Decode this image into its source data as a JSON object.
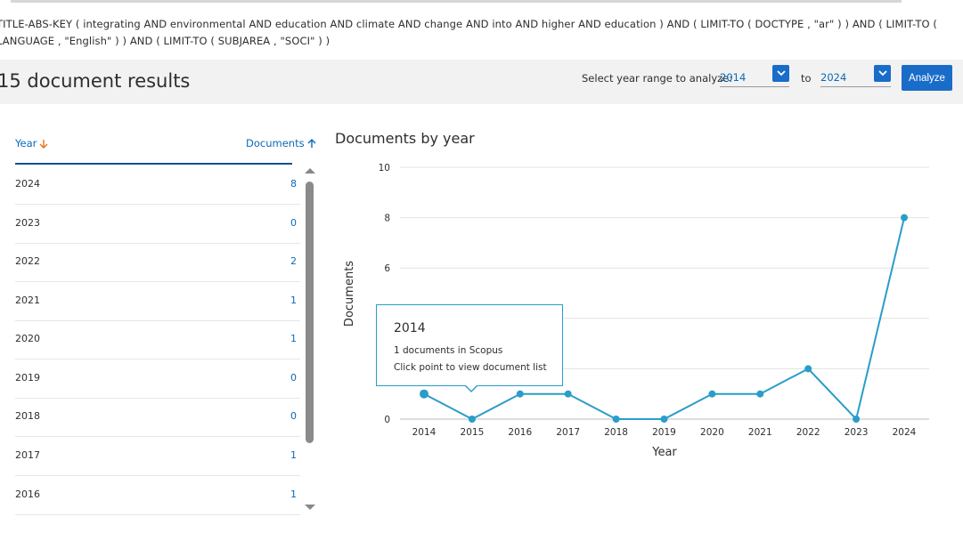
{
  "query": {
    "text": "TITLE-ABS-KEY ( integrating AND environmental AND education AND climate AND change AND into AND higher AND education ) AND ( LIMIT-TO ( DOCTYPE , \"ar\" ) ) AND ( LIMIT-TO ( LANGUAGE , \"English\" ) ) AND ( LIMIT-TO ( SUBJAREA , \"SOCI\" ) )"
  },
  "results": {
    "title": "15 document results"
  },
  "year_range": {
    "label": "Select year range to analyze:",
    "from": "2014",
    "to_label": "to",
    "to": "2024",
    "analyze_label": "Analyze"
  },
  "table": {
    "headers": {
      "year": "Year",
      "documents": "Documents"
    },
    "rows": [
      {
        "year": "2024",
        "count": "8"
      },
      {
        "year": "2023",
        "count": "0"
      },
      {
        "year": "2022",
        "count": "2"
      },
      {
        "year": "2021",
        "count": "1"
      },
      {
        "year": "2020",
        "count": "1"
      },
      {
        "year": "2019",
        "count": "0"
      },
      {
        "year": "2018",
        "count": "0"
      },
      {
        "year": "2017",
        "count": "1"
      },
      {
        "year": "2016",
        "count": "1"
      }
    ]
  },
  "chart_data": {
    "type": "line",
    "title": "Documents by year",
    "xlabel": "Year",
    "ylabel": "Documents",
    "categories": [
      "2014",
      "2015",
      "2016",
      "2017",
      "2018",
      "2019",
      "2020",
      "2021",
      "2022",
      "2023",
      "2024"
    ],
    "values": [
      1,
      0,
      1,
      1,
      0,
      0,
      1,
      1,
      2,
      0,
      8
    ],
    "yticks": [
      0,
      6,
      8,
      10
    ],
    "ylim": [
      0,
      10
    ],
    "grid": true,
    "color": "#2a9dc9"
  },
  "tooltip": {
    "year": "2014",
    "docs": "1 documents in Scopus",
    "hint": "Click point to view document list"
  },
  "colors": {
    "accent": "#1a6cc9",
    "link": "#0a6ab8",
    "sort_arrow": "#e9711c",
    "line": "#2a9dc9"
  }
}
